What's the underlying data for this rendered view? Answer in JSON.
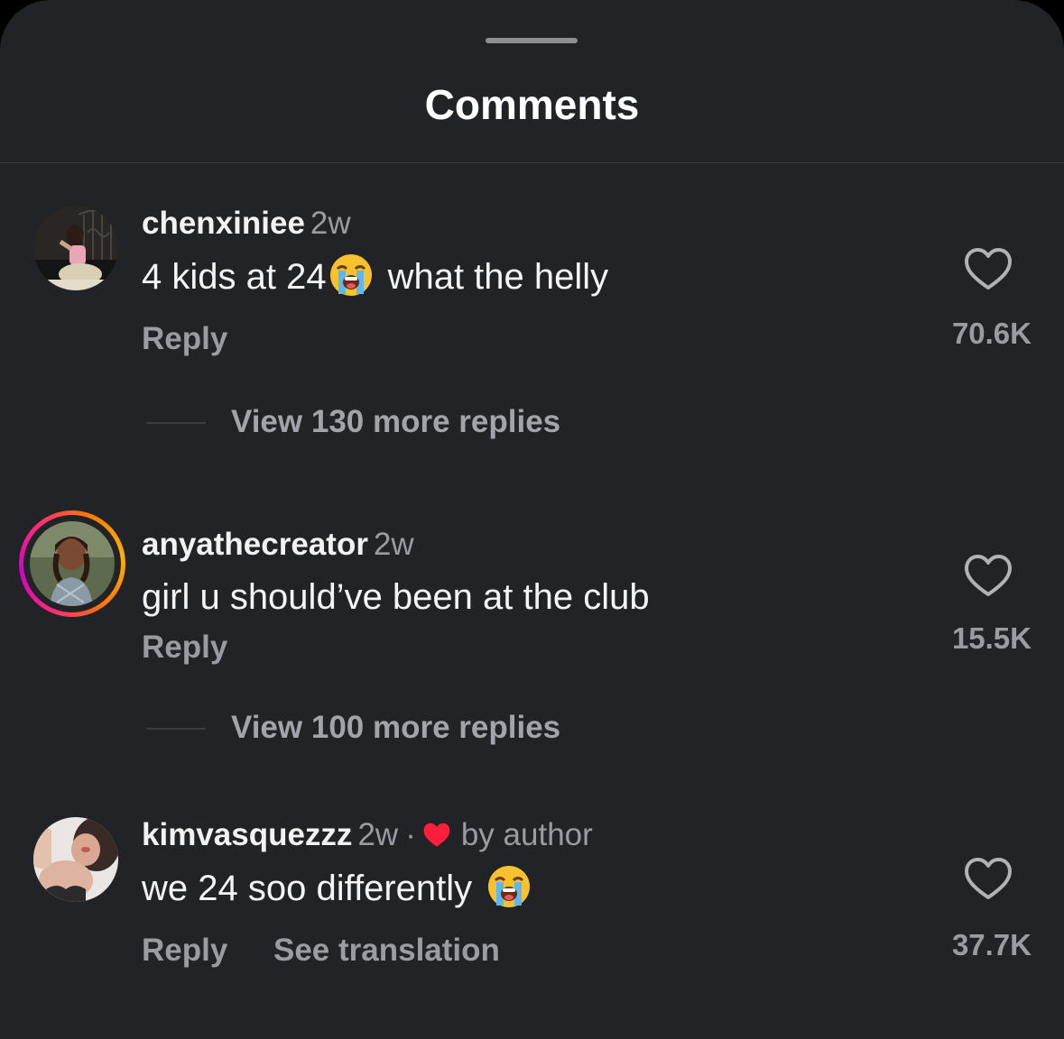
{
  "header": {
    "title": "Comments"
  },
  "comments": [
    {
      "username": "chenxiniee",
      "age": "2w",
      "text_before_emoji": "4 kids at 24",
      "emoji": "loudly-crying-face",
      "text_after_emoji": "what the helly",
      "reply_label": "Reply",
      "likes": "70.6K",
      "view_replies_label": "View 130 more replies"
    },
    {
      "username": "anyathecreator",
      "age": "2w",
      "text": "girl u should’ve been at the club",
      "reply_label": "Reply",
      "likes": "15.5K",
      "has_story_ring": true,
      "view_replies_label": "View 100 more replies"
    },
    {
      "username": "kimvasquezzz",
      "age": "2w",
      "separator": "·",
      "liked_by_author_label": "by author",
      "text": "we 24 soo differently",
      "emoji": "loudly-crying-face",
      "reply_label": "Reply",
      "see_translation_label": "See translation",
      "likes": "37.7K"
    }
  ],
  "colors": {
    "sheet_background": "#222327",
    "primary_text": "#f4f4f6",
    "secondary_text": "#9b9ca3",
    "author_heart": "#ff1f3d",
    "story_ring_start": "#d300c5",
    "story_ring_end": "#ffb100"
  }
}
